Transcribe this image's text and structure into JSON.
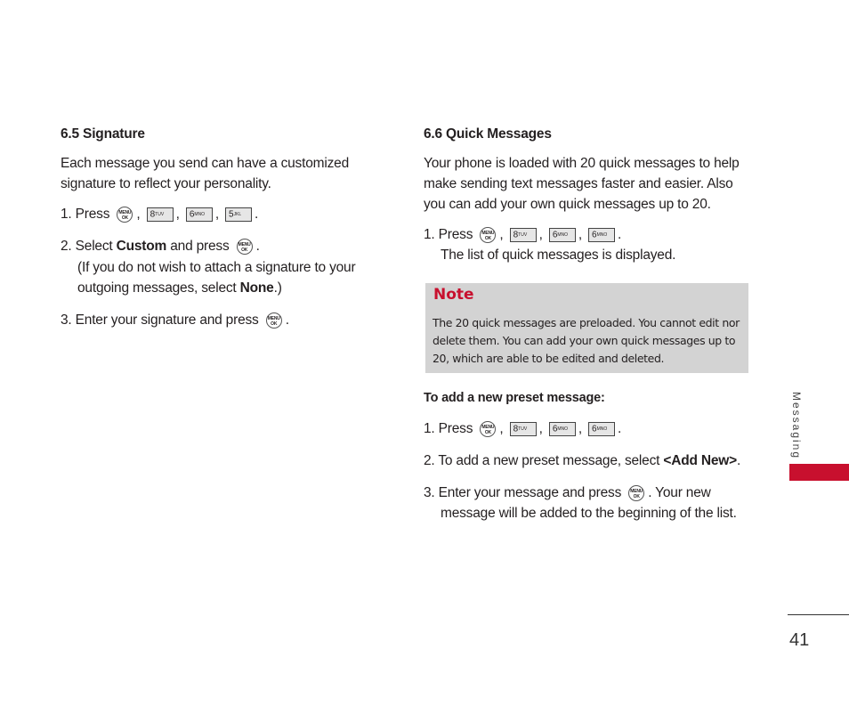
{
  "keys": {
    "menu_ok_top": "MENU",
    "menu_ok_bottom": "OK",
    "k8": "8",
    "k8_sub": "TUV",
    "k6": "6",
    "k6_sub": "MNO",
    "k5": "5",
    "k5_sub": "JKL"
  },
  "signature": {
    "title": "6.5 Signature",
    "intro1": "Each message you send can have a customized",
    "intro2": "signature to reflect your personality.",
    "step1": "1. Press",
    "step2_a": "2. Select ",
    "step2_b": "Custom",
    "step2_c": " and press",
    "step2_d": "(If you do not wish to attach a signature to your",
    "step2_e": "outgoing messages, select ",
    "step2_f": "None",
    "step2_g": ".)",
    "step3": "3. Enter your signature and press"
  },
  "quick": {
    "title": "6.6 Quick Messages",
    "intro1": "Your phone is loaded with 20 quick messages to help",
    "intro2": "make sending text messages faster and easier. Also",
    "intro3": "you can add your own quick messages up to 20.",
    "step1": "1. Press",
    "step1_b": "The list of quick messages is displayed.",
    "note_title": "Note",
    "note1": "The 20 quick messages are preloaded. You cannot edit nor",
    "note2": "delete them. You can add your own quick messages up to",
    "note3": "20, which are able to be edited and deleted.",
    "add_title": "To add a new preset message:",
    "a1": "1. Press",
    "a2_a": "2. To add a new preset message, select ",
    "a2_b": "<Add New>",
    "a2_c": ".",
    "a3_a": "3. Enter your message and press",
    "a3_b": ". Your new",
    "a3_c": "message will be added to the beginning of the list."
  },
  "side_label": "Messaging",
  "page_number": "41",
  "accent_color": "#c8102e"
}
